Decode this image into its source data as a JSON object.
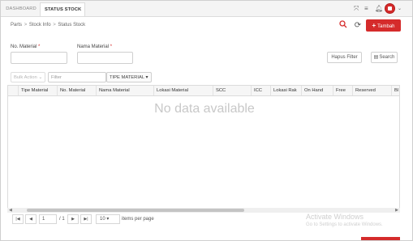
{
  "tabs": [
    {
      "label": "DASHBOARD"
    },
    {
      "label": "STATUS STOCK",
      "close": "×"
    }
  ],
  "topbar_icons": [
    "expand-icon",
    "menu-icon",
    "bell-icon",
    "avatar",
    "chevron-down-icon"
  ],
  "breadcrumb": {
    "items": [
      "Parts",
      "Stock Info",
      "Status Stock"
    ],
    "separator": ">"
  },
  "actions": {
    "tambah_label": "Tambah"
  },
  "form": {
    "no_material_label": "No. Material",
    "nama_material_label": "Nama Material",
    "required_mark": "*",
    "hapus_filter_label": "Hapus Filter",
    "search_label": "Search"
  },
  "table_toolbar": {
    "bulk_action_label": "Bulk Action",
    "filter_placeholder": "Filter",
    "tipe_material_label": "TIPE MATERIAL"
  },
  "table": {
    "columns": [
      "Tipe Material",
      "No. Material",
      "Nama Material",
      "Lokasi Material",
      "SCC",
      "ICC",
      "Lokasi Rak",
      "On Hand",
      "Free",
      "Reserved",
      "Bl"
    ],
    "empty_text": "No data available"
  },
  "pager": {
    "page": "1",
    "of_label": "/ 1",
    "page_size": "10",
    "per_page_label": "items per page"
  },
  "watermark": {
    "title": "Activate Windows",
    "subtitle": "Go to Settings to activate Windows."
  },
  "colors": {
    "accent": "#d52b2b"
  }
}
